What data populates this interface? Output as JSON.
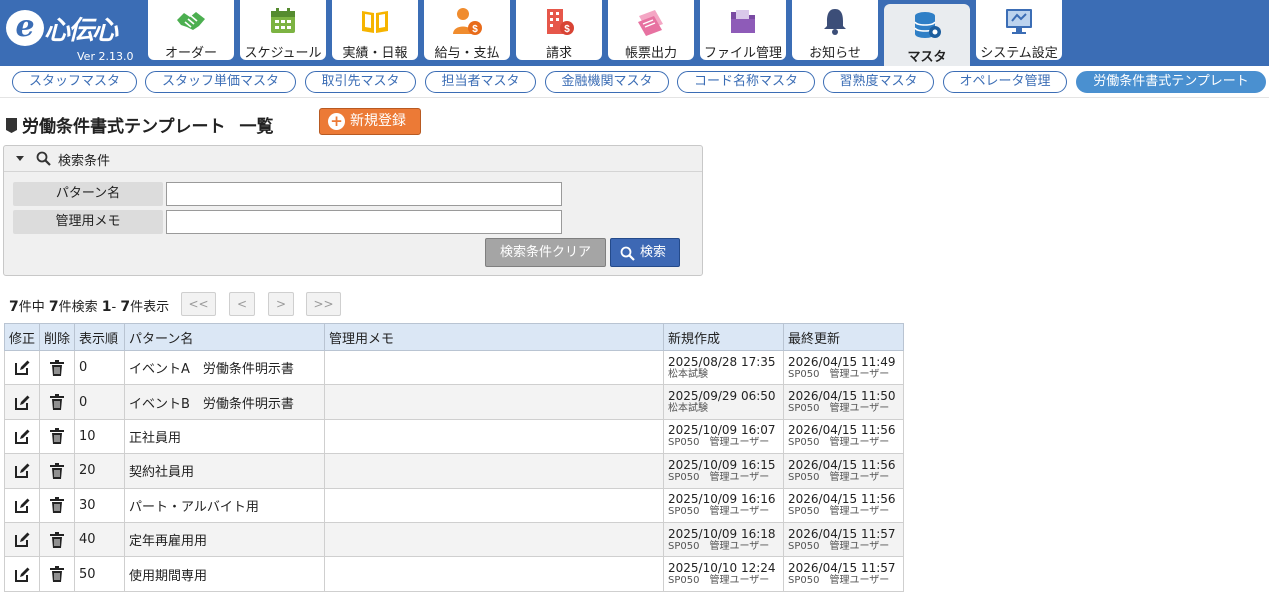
{
  "app": {
    "logo_text": "心伝心",
    "logo_e": "e",
    "version": "Ver 2.13.0"
  },
  "tabs": [
    {
      "label": "オーダー",
      "icon": "handshake-icon"
    },
    {
      "label": "スケジュール",
      "icon": "calendar-icon"
    },
    {
      "label": "実績・日報",
      "icon": "book-icon"
    },
    {
      "label": "給与・支払",
      "icon": "person-coin-icon"
    },
    {
      "label": "請求",
      "icon": "building-coin-icon"
    },
    {
      "label": "帳票出力",
      "icon": "papers-icon"
    },
    {
      "label": "ファイル管理",
      "icon": "folder-icon"
    },
    {
      "label": "お知らせ",
      "icon": "bell-icon"
    },
    {
      "label": "マスタ",
      "icon": "database-gear-icon",
      "active": true
    },
    {
      "label": "システム設定",
      "icon": "monitor-settings-icon"
    }
  ],
  "subnav": [
    "スタッフマスタ",
    "スタッフ単価マスタ",
    "取引先マスタ",
    "担当者マスタ",
    "金融機関マスタ",
    "コード名称マスタ",
    "習熟度マスタ",
    "オペレータ管理",
    "労働条件書式テンプレート"
  ],
  "page": {
    "title": "労働条件書式テンプレート",
    "subtitle": "一覧",
    "new_button": "新規登録"
  },
  "search": {
    "header": "検索条件",
    "fields": [
      {
        "label": "パターン名",
        "value": "",
        "placeholder": ""
      },
      {
        "label": "管理用メモ",
        "value": "",
        "placeholder": ""
      }
    ],
    "clear_button": "検索条件クリア",
    "search_button": "検索"
  },
  "pager": {
    "total": "7",
    "found": "7",
    "from": "1",
    "to": "7",
    "first": "<<",
    "prev": "<",
    "next": ">",
    "last": ">>",
    "t1": "件中 ",
    "t2": "件検索 ",
    "t3": "- ",
    "t4": "件表示"
  },
  "table": {
    "headers": [
      "修正",
      "削除",
      "表示順",
      "パターン名",
      "管理用メモ",
      "新規作成",
      "最終更新"
    ],
    "rows": [
      {
        "order": "0",
        "name": "イベントA　労働条件明示書",
        "memo": "",
        "created": "2025/08/28 17:35",
        "created_by": "松本試験",
        "updated": "2026/04/15 11:49",
        "updated_by": "SP050　管理ユーザー"
      },
      {
        "order": "0",
        "name": "イベントB　労働条件明示書",
        "memo": "",
        "created": "2025/09/29 06:50",
        "created_by": "松本試験",
        "updated": "2026/04/15 11:50",
        "updated_by": "SP050　管理ユーザー"
      },
      {
        "order": "10",
        "name": "正社員用",
        "memo": "",
        "created": "2025/10/09 16:07",
        "created_by": "SP050　管理ユーザー",
        "updated": "2026/04/15 11:56",
        "updated_by": "SP050　管理ユーザー"
      },
      {
        "order": "20",
        "name": "契約社員用",
        "memo": "",
        "created": "2025/10/09 16:15",
        "created_by": "SP050　管理ユーザー",
        "updated": "2026/04/15 11:56",
        "updated_by": "SP050　管理ユーザー"
      },
      {
        "order": "30",
        "name": "パート・アルバイト用",
        "memo": "",
        "created": "2025/10/09 16:16",
        "created_by": "SP050　管理ユーザー",
        "updated": "2026/04/15 11:56",
        "updated_by": "SP050　管理ユーザー"
      },
      {
        "order": "40",
        "name": "定年再雇用用",
        "memo": "",
        "created": "2025/10/09 16:18",
        "created_by": "SP050　管理ユーザー",
        "updated": "2026/04/15 11:57",
        "updated_by": "SP050　管理ユーザー"
      },
      {
        "order": "50",
        "name": "使用期間専用",
        "memo": "",
        "created": "2025/10/10 12:24",
        "created_by": "SP050　管理ユーザー",
        "updated": "2026/04/15 11:57",
        "updated_by": "SP050　管理ユーザー"
      }
    ]
  },
  "colors": {
    "header_bg": "#3b6db5",
    "accent_orange": "#ec7a36",
    "pill_active": "#4a90d0",
    "table_head": "#dbe7f5"
  }
}
